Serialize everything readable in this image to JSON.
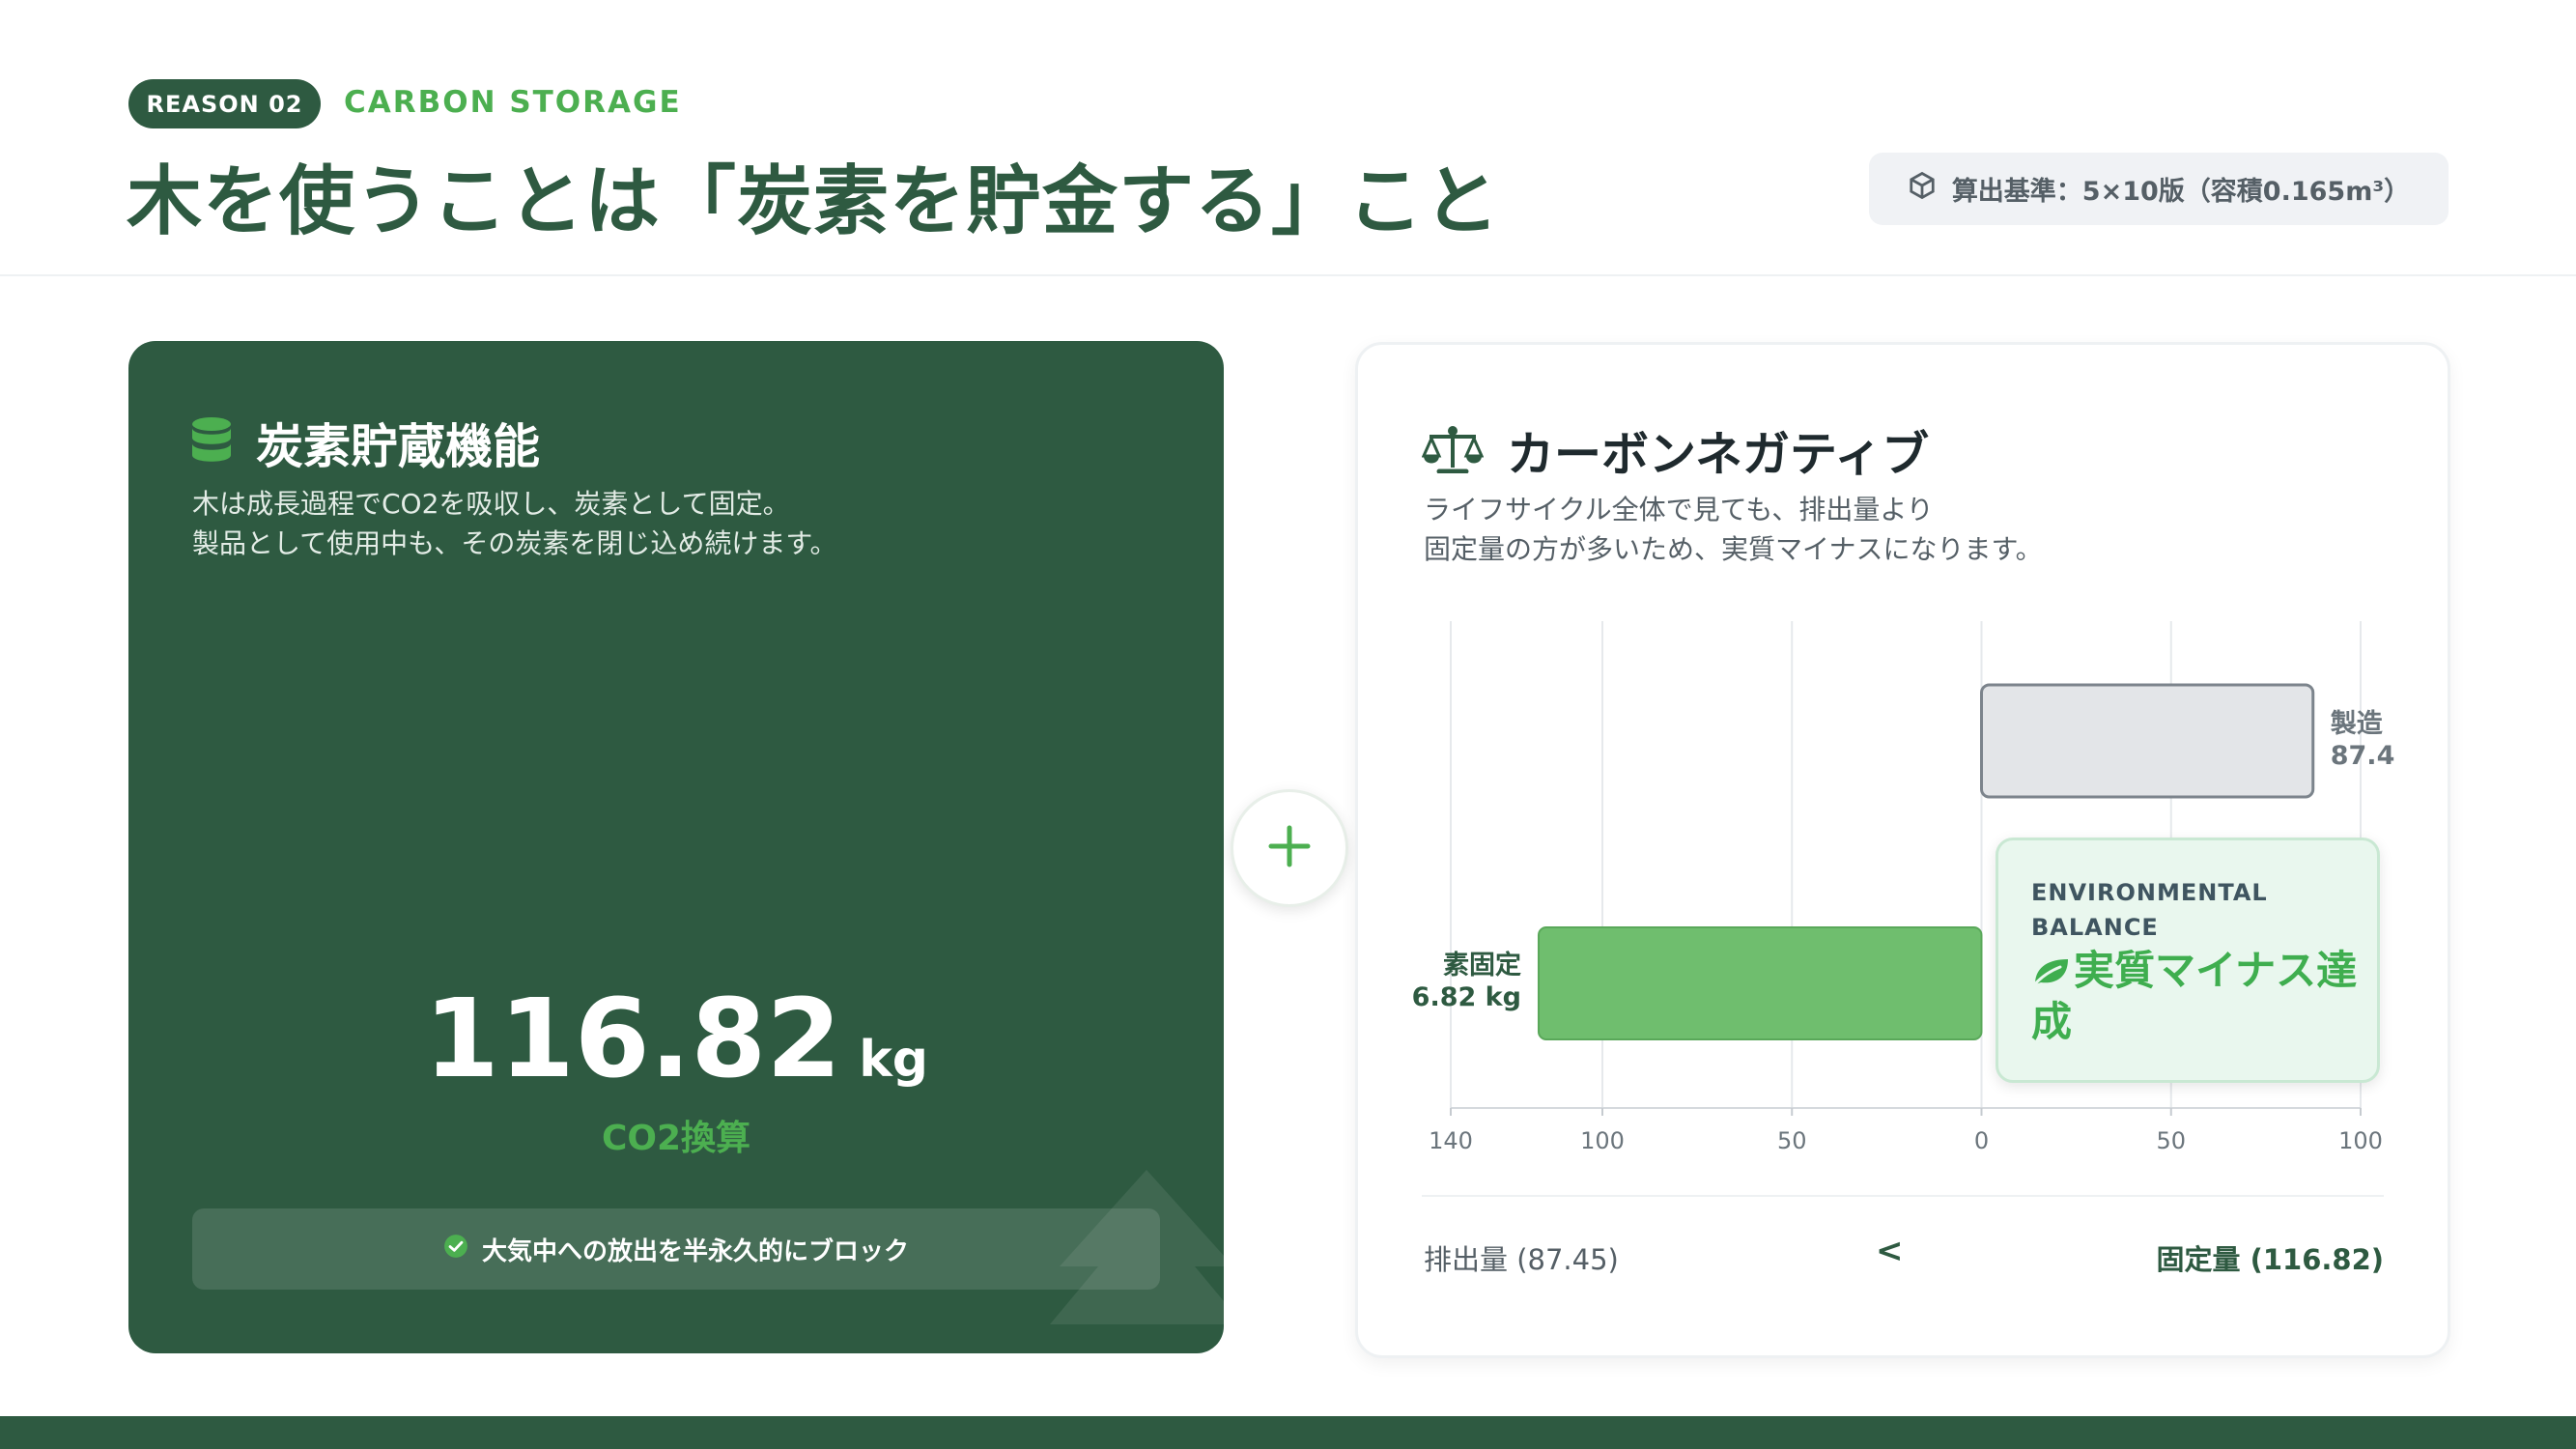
{
  "header": {
    "reason_tag": "REASON 02",
    "section_label": "CARBON STORAGE",
    "title": "木を使うことは「炭素を貯金する」こと",
    "basis": "算出基準：5×10版（容積0.165m³）"
  },
  "storage_card": {
    "title": "炭素貯蔵機能",
    "desc_line1": "木は成長過程でCO2を吸収し、炭素として固定。",
    "desc_line2": "製品として使用中も、その炭素を閉じ込め続けます。",
    "value": "116.82",
    "unit": "kg",
    "value_label": "CO2換算",
    "note": "大気中への放出を半永久的にブロック"
  },
  "balance_card": {
    "title": "カーボンネガティブ",
    "desc_line1": "ライフサイクル全体で見ても、排出量より",
    "desc_line2": "固定量の方が多いため、実質マイナスになります。",
    "badge_label_line1": "ENVIRONMENTAL",
    "badge_label_line2": "BALANCE",
    "badge_main": "実質マイナス達成",
    "footer_left": "排出量 (87.45)",
    "footer_mid": "<",
    "footer_right": "固定量 (116.82)"
  },
  "chart_data": {
    "type": "bar",
    "orientation": "horizontal",
    "categories": [
      "製造",
      "素固定"
    ],
    "series": [
      {
        "name": "排出量",
        "category": "製造",
        "value": 87.45,
        "color": "#e3e5e8"
      },
      {
        "name": "固定量",
        "category": "素固定",
        "value": -116.82,
        "color": "#6fbe6e"
      }
    ],
    "bar_labels": [
      {
        "line1": "製造",
        "line2": "87.4"
      },
      {
        "line1": "素固定",
        "line2": "6.82 kg"
      }
    ],
    "x_ticks": [
      -140,
      -100,
      -50,
      0,
      50,
      100
    ],
    "x_tick_labels": [
      "140",
      "100",
      "50",
      "0",
      "50",
      "100"
    ],
    "xlim": [
      -140,
      100
    ],
    "grid": true
  },
  "colors": {
    "brand_dark": "#2e5a41",
    "accent_green": "#4caf50",
    "bar_gray": "#e3e5e8",
    "bar_green": "#6fbe6e"
  },
  "icons": {
    "basis": "box-icon",
    "storage": "database-icon",
    "balance": "scale-icon",
    "note": "check-circle-icon",
    "plus": "plus-icon",
    "badge": "leaf-icon"
  }
}
